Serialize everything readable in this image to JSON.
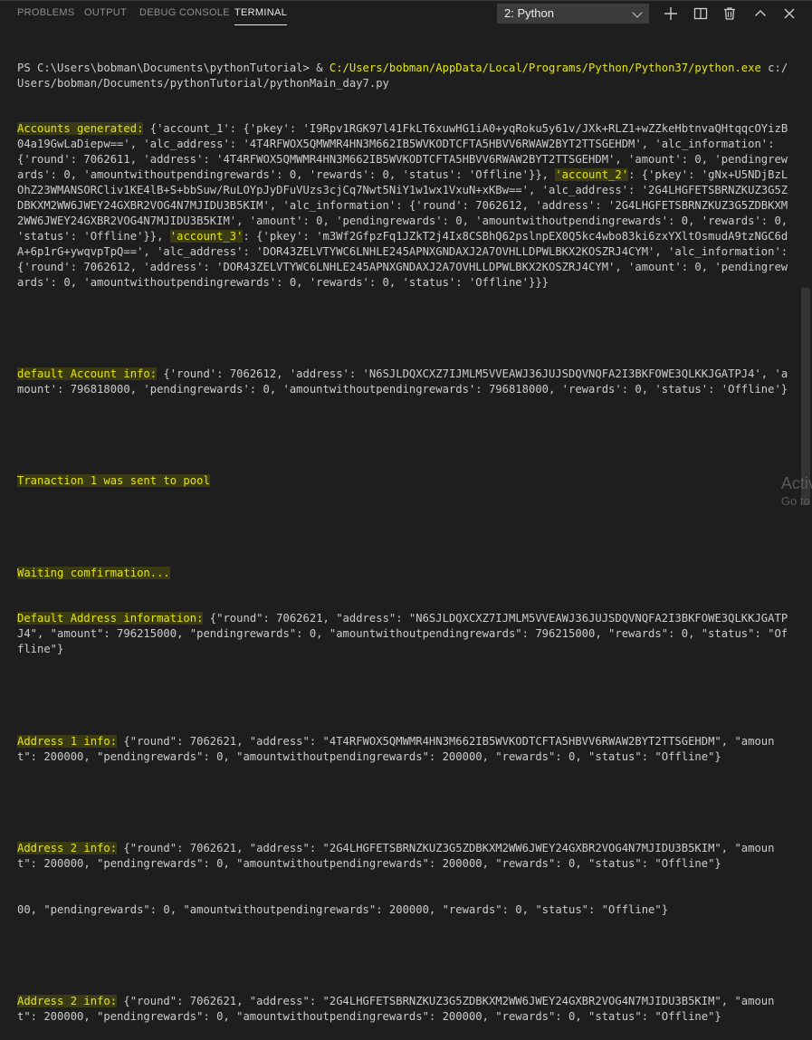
{
  "panel": {
    "tabs": [
      {
        "label": "PROBLEMS"
      },
      {
        "label": "OUTPUT"
      },
      {
        "label": "DEBUG CONSOLE"
      },
      {
        "label": "TERMINAL"
      }
    ],
    "active_tab": "TERMINAL",
    "terminal_select": "2: Python",
    "icons": [
      "plus-icon",
      "split-terminal-icon",
      "trash-icon",
      "chevron-up-icon",
      "close-icon"
    ]
  },
  "terminal": {
    "prompt": "PS C:\\Users\\bobman\\Documents\\pythonTutorial> ",
    "cmd_amp": "& ",
    "cmd_exe": "C:/Users/bobman/AppData/Local/Programs/Python/Python37/python.exe",
    "cmd_rest": " c:/Users/bobman/Documents/pythonTutorial/pythonMain_day7.py",
    "accounts_label": "Accounts generated:",
    "acc_part1": " {'account_1': {'pkey': 'I9Rpv1RGK97l41FkLT6xuwHG1iA0+yqRoku5y61v/JXk+RLZ1+wZZkeHbtnvaQHtqqcOYizB04a19GwLaDiepw==', 'alc_address': '4T4RFWOX5QMWMR4HN3M662IB5WVKODTCFTA5HBVV6RWAW2BYT2TTSGEHDM', 'alc_information': {'round': 7062611, 'address': '4T4RFWOX5QMWMR4HN3M662IB5WVKODTCFTA5HBVV6RWAW2BYT2TTSGEHDM', 'amount': 0, 'pendingrewards': 0, 'amountwithoutpendingrewards': 0, 'rewards': 0, 'status': 'Offline'}}, ",
    "acc2_label": "'account_2'",
    "acc_part2": ": {'pkey': 'gNx+U5NDjBzLOhZ23WMANSORCliv1KE4lB+S+bbSuw/RuLOYpJyDFuVUzs3cjCq7Nwt5NiY1w1wx1VxuN+xKBw==', 'alc_address': '2G4LHGFETSBRNZKUZ3G5ZDBKXM2WW6JWEY24GXBR2VOG4N7MJIDU3B5KIM', 'alc_information': {'round': 7062612, 'address': '2G4LHGFETSBRNZKUZ3G5ZDBKXM2WW6JWEY24GXBR2VOG4N7MJIDU3B5KIM', 'amount': 0, 'pendingrewards': 0, 'amountwithoutpendingrewards': 0, 'rewards': 0, 'status': 'Offline'}}, ",
    "acc3_label": "'account_3'",
    "acc_part3": ": {'pkey': 'm3Wf2GfpzFq1JZkT2j4Ix8CSBhQ62pslnpEX0Q5kc4wbo83ki6zxYXltOsmudA9tzNGC6dA+6p1rG+ywqvpTpQ==', 'alc_address': 'DOR43ZELVTYWC6LNHLE245APNXGNDAXJ2A7OVHLLDPWLBKX2KOSZRJ4CYM', 'alc_information': {'round': 7062612, 'address': 'DOR43ZELVTYWC6LNHLE245APNXGNDAXJ2A7OVHLLDPWLBKX2KOSZRJ4CYM', 'amount': 0, 'pendingrewards': 0, 'amountwithoutpendingrewards': 0, 'rewards': 0, 'status': 'Offline'}}}",
    "default_label": "default Account info:",
    "default_text": " {'round': 7062612, 'address': 'N6SJLDQXCXZ7IJMLM5VVEAWJ36JUJSDQVNQFA2I3BKFOWE3QLKKJGATPJ4', 'amount': 796818000, 'pendingrewards': 0, 'amountwithoutpendingrewards': 796818000, 'rewards': 0, 'status': 'Offline'}",
    "tx_sent": "Tranaction 1 was sent to pool",
    "waiting": "Waiting comfirmation...",
    "default_addr_label": "Default Address information:",
    "default_addr_text": " {\"round\": 7062621, \"address\": \"N6SJLDQXCXZ7IJMLM5VVEAWJ36JUJSDQVNQFA2I3BKFOWE3QLKKJGATPJ4\", \"amount\": 796215000, \"pendingrewards\": 0, \"amountwithoutpendingrewards\": 796215000, \"rewards\": 0, \"status\": \"Offline\"}",
    "addr1_label": "Address 1 info:",
    "addr1_text": " {\"round\": 7062621, \"address\": \"4T4RFWOX5QMWMR4HN3M662IB5WVKODTCFTA5HBVV6RWAW2BYT2TTSGEHDM\", \"amount\": 200000, \"pendingrewards\": 0, \"amountwithoutpendingrewards\": 200000, \"rewards\": 0, \"status\": \"Offline\"}",
    "addr2_label": "Address 2 info:",
    "addr2_text": " {\"round\": 7062621, \"address\": \"2G4LHGFETSBRNZKUZ3G5ZDBKXM2WW6JWEY24GXBR2VOG4N7MJIDU3B5KIM\", \"amount\": 200000, \"pendingrewards\": 0, \"amountwithoutpendingrewards\": 200000, \"rewards\": 0, \"status\": \"Offline\"}",
    "addr2_extra": "00, \"pendingrewards\": 0, \"amountwithoutpendingrewards\": 200000, \"rewards\": 0, \"status\": \"Offline\"}",
    "addr2b_label": "Address 2 info:",
    "addr2b_text": " {\"round\": 7062621, \"address\": \"2G4LHGFETSBRNZKUZ3G5ZDBKXM2WW6JWEY24GXBR2VOG4N7MJIDU3B5KIM\", \"amount\": 200000, \"pendingrewards\": 0, \"amountwithoutpendingrewards\": 200000, \"rewards\": 0, \"status\": \"Offline\"}"
  },
  "watermark": {
    "line1": "Activ",
    "line2": "Go to S"
  },
  "colors": {
    "background": "#1e1e1e",
    "text": "#cccccc",
    "highlight": "#e5e510",
    "tab_active": "#e7e7e7"
  }
}
